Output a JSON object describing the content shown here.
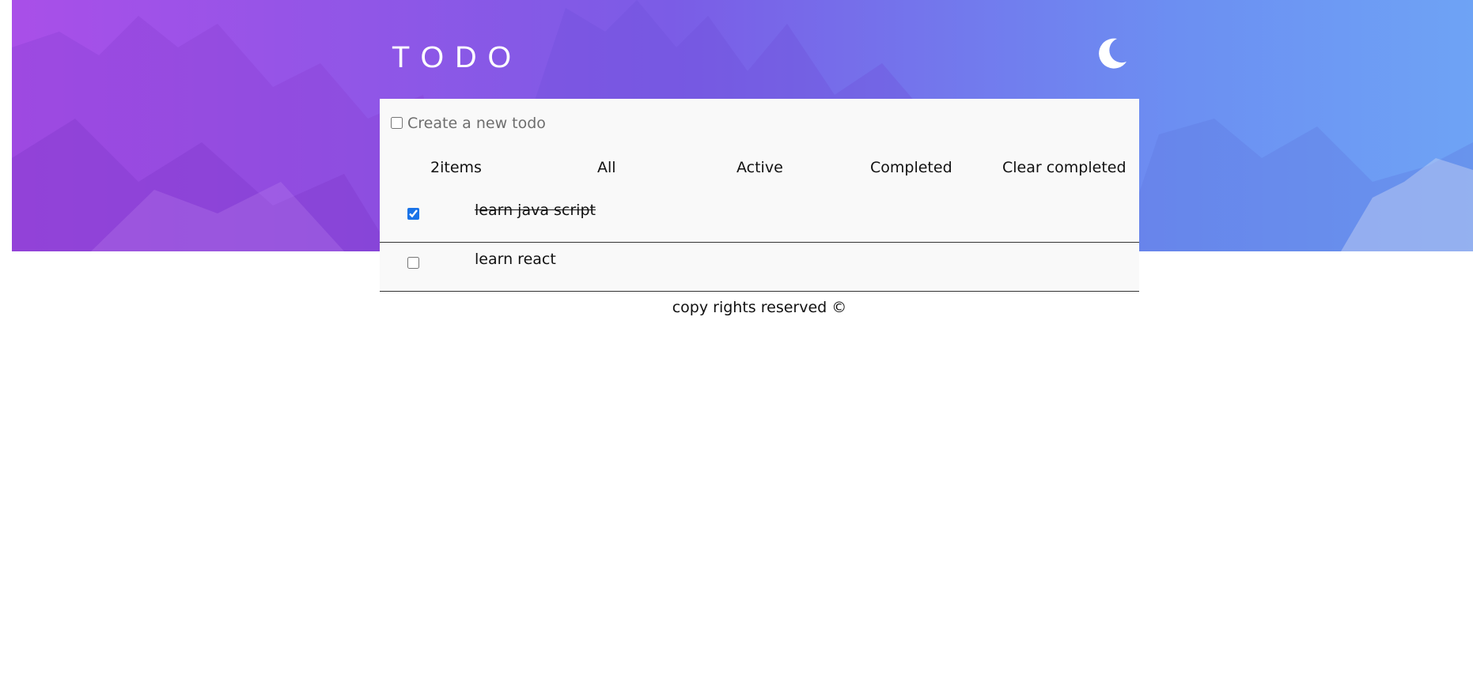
{
  "header": {
    "title": "TODO",
    "theme_icon": "moon-icon"
  },
  "new_todo": {
    "placeholder": "Create a new todo",
    "value": ""
  },
  "filters": {
    "count": "2items",
    "all": "All",
    "active": "Active",
    "completed": "Completed",
    "clear": "Clear completed"
  },
  "todos": [
    {
      "text": "learn java script",
      "completed": true
    },
    {
      "text": "learn react",
      "completed": false
    }
  ],
  "footer": {
    "text": "copy rights reserved ©"
  },
  "colors": {
    "banner_start": "#a94fe8",
    "banner_end": "#6ea3f5",
    "panel_bg": "#f9f9f9",
    "checkbox_accent": "#1a73e8"
  }
}
